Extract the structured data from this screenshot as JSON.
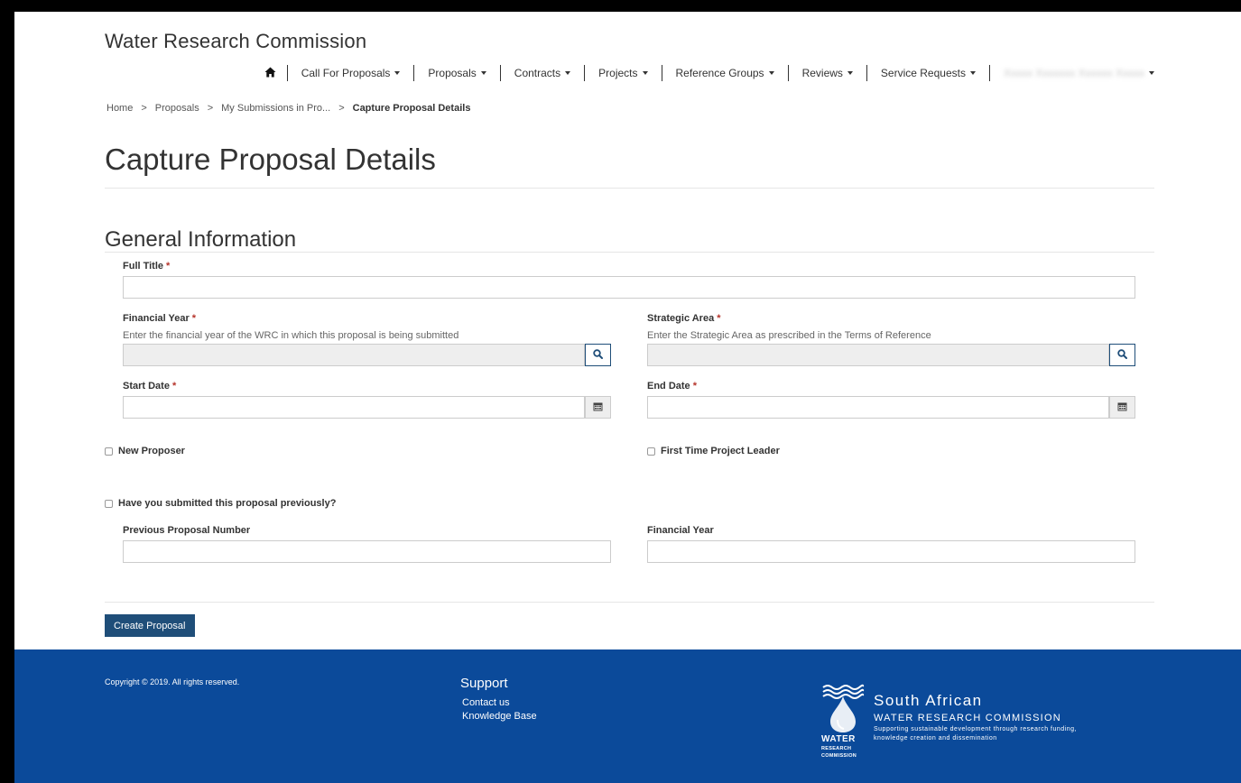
{
  "header": {
    "brand": "Water Research Commission",
    "nav": [
      {
        "label": "Call For Proposals"
      },
      {
        "label": "Proposals"
      },
      {
        "label": "Contracts"
      },
      {
        "label": "Projects"
      },
      {
        "label": "Reference Groups"
      },
      {
        "label": "Reviews"
      },
      {
        "label": "Service Requests"
      }
    ],
    "user_name": "Xxxxx Xxxxxxx Xxxxxx Xxxxx"
  },
  "breadcrumb": [
    "Home",
    "Proposals",
    "My Submissions in Pro...",
    "Capture Proposal Details"
  ],
  "breadcrumb_separator": ">",
  "page_title": "Capture Proposal Details",
  "section_title": "General Information",
  "form": {
    "required_marker": "*",
    "full_title": {
      "label": "Full Title",
      "value": ""
    },
    "financial_year": {
      "label": "Financial Year",
      "help": "Enter the financial year of the WRC in which this proposal is being submitted",
      "value": ""
    },
    "strategic_area": {
      "label": "Strategic Area",
      "help": "Enter the Strategic Area as prescribed in the Terms of Reference",
      "value": ""
    },
    "start_date": {
      "label": "Start Date",
      "value": ""
    },
    "end_date": {
      "label": "End Date",
      "value": ""
    },
    "new_proposer": {
      "label": "New Proposer",
      "checked": false
    },
    "first_time_leader": {
      "label": "First Time Project Leader",
      "checked": false
    },
    "submitted_previously": {
      "label": "Have you submitted this proposal previously?",
      "checked": false
    },
    "previous_proposal_number": {
      "label": "Previous Proposal Number",
      "value": ""
    },
    "previous_financial_year": {
      "label": "Financial Year",
      "value": ""
    },
    "submit_label": "Create Proposal"
  },
  "footer": {
    "copyright": "Copyright © 2019. All rights reserved.",
    "support_title": "Support",
    "support_links": [
      "Contact us",
      "Knowledge Base"
    ],
    "logo": {
      "line1": "South African",
      "line2": "WATER RESEARCH COMMISSION",
      "line3": "Supporting sustainable development through research funding, knowledge creation and dissemination",
      "word1": "WATER",
      "word2": "RESEARCH",
      "word3": "COMMISSION"
    }
  },
  "colors": {
    "primary": "#1f4e79",
    "footer_bg": "#0b4a9a",
    "required": "#b5332a"
  }
}
